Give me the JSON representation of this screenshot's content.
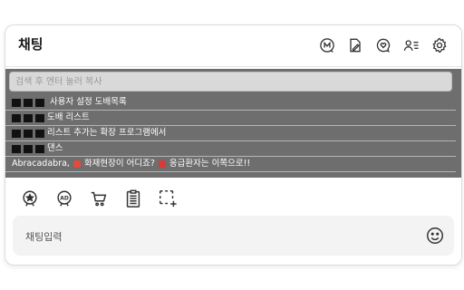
{
  "header": {
    "title": "채팅",
    "icons": [
      "mod-badge-icon",
      "note-edit-icon",
      "chat-heart-icon",
      "user-list-icon",
      "gear-icon"
    ]
  },
  "search": {
    "placeholder": "검색 후 엔터 눌러 복사"
  },
  "suggestions": [
    {
      "label": "사용자 설정 도배목록",
      "prefix_blocks": 3
    },
    {
      "label": "도배 리스트",
      "prefix_blocks": 3
    },
    {
      "label": "리스트 추가는 확장 프로그램에서",
      "prefix_blocks": 3
    },
    {
      "label": "댄스",
      "prefix_blocks": 3
    },
    {
      "label_pre": "Abracadabra, ",
      "label_post": "화재현장이 어디죠?",
      "label_tail": "응급환자는 이쪽으로!!"
    }
  ],
  "toolbar": {
    "icons": [
      "star-badge-icon",
      "ad-badge-icon",
      "cart-icon",
      "clipboard-icon",
      "add-region-icon"
    ]
  },
  "chat_input": {
    "placeholder": "채팅입력"
  },
  "colors": {
    "overlay": "#6e6e6e",
    "search_bg": "#d9d9d9",
    "input_bg": "#f3f3f3"
  }
}
